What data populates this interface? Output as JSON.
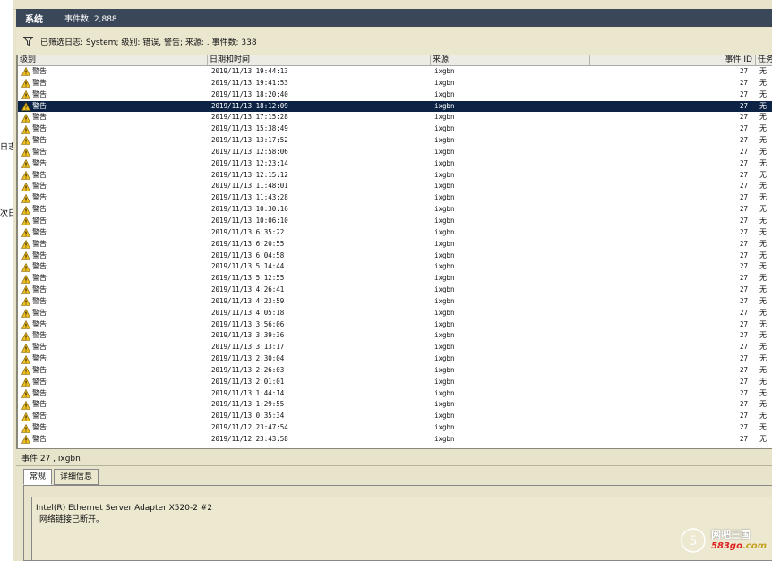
{
  "left_panel": {
    "fragments": [
      "日志",
      "次日"
    ]
  },
  "titlebar": {
    "name": "系统",
    "count_text": "事件数: 2,888"
  },
  "filter": {
    "text": "已筛选日志: System; 级别: 错误, 警告; 来源: . 事件数: 338"
  },
  "columns": {
    "level": "级别",
    "datetime": "日期和时间",
    "source": "来源",
    "event_id": "事件 ID",
    "task": "任务"
  },
  "events": [
    {
      "level": "警告",
      "datetime": "2019/11/13 19:44:13",
      "source": "ixgbn",
      "id": "27",
      "task": "无"
    },
    {
      "level": "警告",
      "datetime": "2019/11/13 19:41:53",
      "source": "ixgbn",
      "id": "27",
      "task": "无"
    },
    {
      "level": "警告",
      "datetime": "2019/11/13 18:20:40",
      "source": "ixgbn",
      "id": "27",
      "task": "无"
    },
    {
      "level": "警告",
      "datetime": "2019/11/13 18:12:09",
      "source": "ixgbn",
      "id": "27",
      "task": "无",
      "selected": true
    },
    {
      "level": "警告",
      "datetime": "2019/11/13 17:15:28",
      "source": "ixgbn",
      "id": "27",
      "task": "无"
    },
    {
      "level": "警告",
      "datetime": "2019/11/13 15:38:49",
      "source": "ixgbn",
      "id": "27",
      "task": "无"
    },
    {
      "level": "警告",
      "datetime": "2019/11/13 13:17:52",
      "source": "ixgbn",
      "id": "27",
      "task": "无"
    },
    {
      "level": "警告",
      "datetime": "2019/11/13 12:58:06",
      "source": "ixgbn",
      "id": "27",
      "task": "无"
    },
    {
      "level": "警告",
      "datetime": "2019/11/13 12:23:14",
      "source": "ixgbn",
      "id": "27",
      "task": "无"
    },
    {
      "level": "警告",
      "datetime": "2019/11/13 12:15:12",
      "source": "ixgbn",
      "id": "27",
      "task": "无"
    },
    {
      "level": "警告",
      "datetime": "2019/11/13 11:48:01",
      "source": "ixgbn",
      "id": "27",
      "task": "无"
    },
    {
      "level": "警告",
      "datetime": "2019/11/13 11:43:28",
      "source": "ixgbn",
      "id": "27",
      "task": "无"
    },
    {
      "level": "警告",
      "datetime": "2019/11/13 10:30:16",
      "source": "ixgbn",
      "id": "27",
      "task": "无"
    },
    {
      "level": "警告",
      "datetime": "2019/11/13 10:06:10",
      "source": "ixgbn",
      "id": "27",
      "task": "无"
    },
    {
      "level": "警告",
      "datetime": "2019/11/13 6:35:22",
      "source": "ixgbn",
      "id": "27",
      "task": "无"
    },
    {
      "level": "警告",
      "datetime": "2019/11/13 6:20:55",
      "source": "ixgbn",
      "id": "27",
      "task": "无"
    },
    {
      "level": "警告",
      "datetime": "2019/11/13 6:04:58",
      "source": "ixgbn",
      "id": "27",
      "task": "无"
    },
    {
      "level": "警告",
      "datetime": "2019/11/13 5:14:44",
      "source": "ixgbn",
      "id": "27",
      "task": "无"
    },
    {
      "level": "警告",
      "datetime": "2019/11/13 5:12:55",
      "source": "ixgbn",
      "id": "27",
      "task": "无"
    },
    {
      "level": "警告",
      "datetime": "2019/11/13 4:26:41",
      "source": "ixgbn",
      "id": "27",
      "task": "无"
    },
    {
      "level": "警告",
      "datetime": "2019/11/13 4:23:59",
      "source": "ixgbn",
      "id": "27",
      "task": "无"
    },
    {
      "level": "警告",
      "datetime": "2019/11/13 4:05:18",
      "source": "ixgbn",
      "id": "27",
      "task": "无"
    },
    {
      "level": "警告",
      "datetime": "2019/11/13 3:56:06",
      "source": "ixgbn",
      "id": "27",
      "task": "无"
    },
    {
      "level": "警告",
      "datetime": "2019/11/13 3:39:36",
      "source": "ixgbn",
      "id": "27",
      "task": "无"
    },
    {
      "level": "警告",
      "datetime": "2019/11/13 3:13:17",
      "source": "ixgbn",
      "id": "27",
      "task": "无"
    },
    {
      "level": "警告",
      "datetime": "2019/11/13 2:30:04",
      "source": "ixgbn",
      "id": "27",
      "task": "无"
    },
    {
      "level": "警告",
      "datetime": "2019/11/13 2:26:03",
      "source": "ixgbn",
      "id": "27",
      "task": "无"
    },
    {
      "level": "警告",
      "datetime": "2019/11/13 2:01:01",
      "source": "ixgbn",
      "id": "27",
      "task": "无"
    },
    {
      "level": "警告",
      "datetime": "2019/11/13 1:44:14",
      "source": "ixgbn",
      "id": "27",
      "task": "无"
    },
    {
      "level": "警告",
      "datetime": "2019/11/13 1:29:55",
      "source": "ixgbn",
      "id": "27",
      "task": "无"
    },
    {
      "level": "警告",
      "datetime": "2019/11/13 0:35:34",
      "source": "ixgbn",
      "id": "27",
      "task": "无"
    },
    {
      "level": "警告",
      "datetime": "2019/11/12 23:47:54",
      "source": "ixgbn",
      "id": "27",
      "task": "无"
    },
    {
      "level": "警告",
      "datetime": "2019/11/12 23:43:58",
      "source": "ixgbn",
      "id": "27",
      "task": "无"
    }
  ],
  "detail": {
    "header": "事件 27 , ixgbn",
    "tabs": [
      "常规",
      "详细信息"
    ],
    "line1": "Intel(R) Ethernet Server Adapter X520-2 #2",
    "line2": "网络链接已断开。"
  },
  "watermark": {
    "cn": "网吧三国",
    "en_num": "583go",
    "en_dom": ".com"
  },
  "colors": {
    "selected_row": "#0c2346",
    "titlebar": "#3a4758",
    "warning": "#f0c020"
  },
  "icons": {
    "warning": "warning-triangle-icon",
    "filter": "funnel-icon"
  }
}
